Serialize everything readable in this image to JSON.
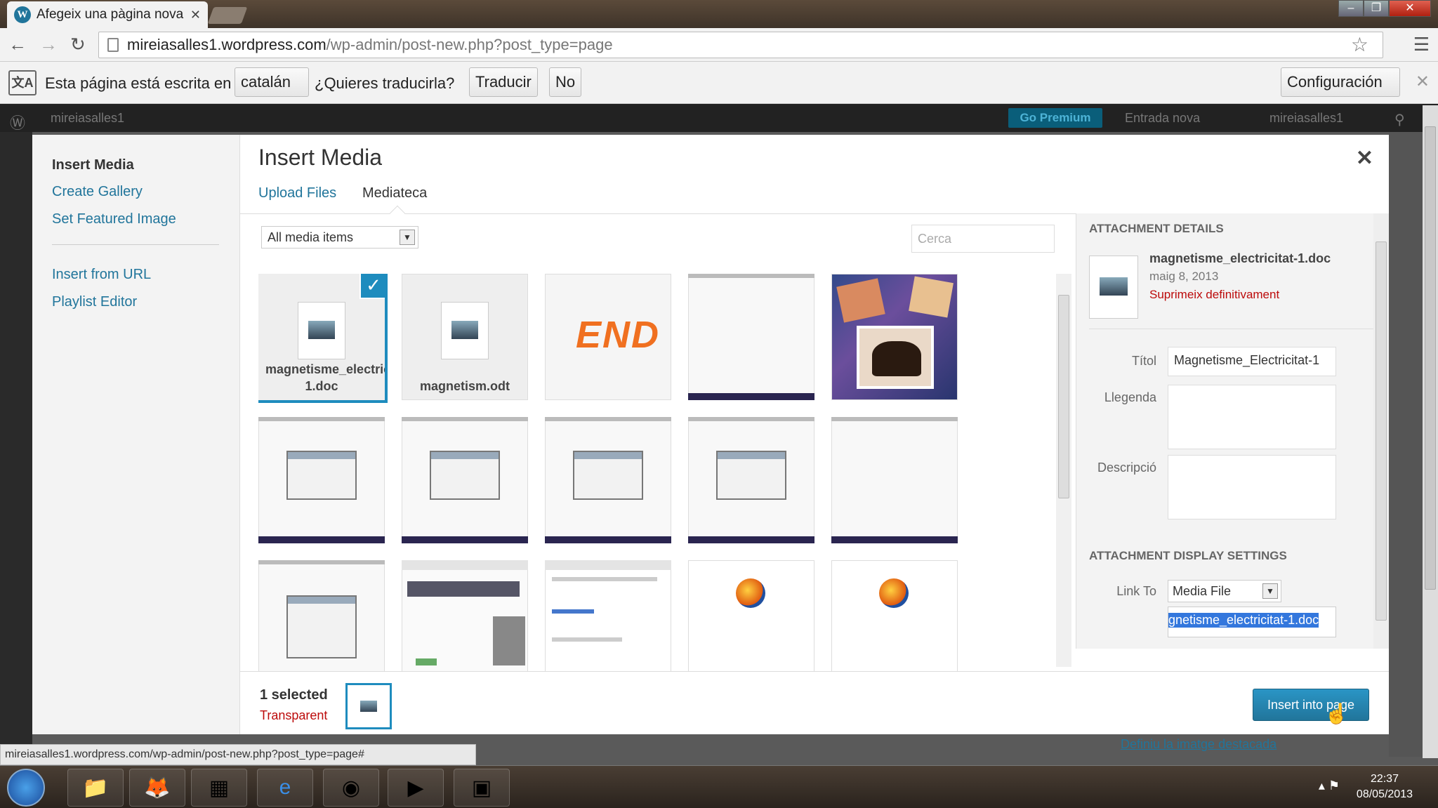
{
  "browser": {
    "tab_title": "Afegeix una pàgina nova ‹",
    "url_domain": "mireiasalles1.wordpress.com",
    "url_path": "/wp-admin/post-new.php?post_type=page"
  },
  "translate_bar": {
    "text_prefix": "Esta página está escrita en",
    "language": "catalán",
    "question": "¿Quieres traducirla?",
    "translate_button": "Traducir",
    "no_button": "No",
    "settings_button": "Configuración"
  },
  "admin_bar": {
    "site": "mireiasalles1",
    "go_premium": "Go Premium",
    "new_post": "Entrada nova",
    "user": "mireiasalles1"
  },
  "media_modal": {
    "menu": {
      "insert_media": "Insert Media",
      "create_gallery": "Create Gallery",
      "set_featured": "Set Featured Image",
      "insert_url": "Insert from URL",
      "playlist_editor": "Playlist Editor"
    },
    "title": "Insert Media",
    "router": {
      "upload": "Upload Files",
      "library": "Mediateca"
    },
    "filter": "All media items",
    "search_placeholder": "Cerca",
    "attachments": [
      {
        "name": "magnetisme_electricitat-1.doc",
        "type": "doc",
        "selected": true
      },
      {
        "name": "magnetism.odt",
        "type": "doc"
      },
      {
        "name": "END",
        "type": "image"
      },
      {
        "type": "screenshot"
      },
      {
        "type": "collage"
      }
    ],
    "details": {
      "heading": "Attachment Details",
      "filename": "magnetisme_electricitat-1.doc",
      "date": "maig 8, 2013",
      "delete_link": "Suprimeix definitivament",
      "title_label": "Títol",
      "title_value": "Magnetisme_Electricitat-1",
      "caption_label": "Llegenda",
      "description_label": "Descripció",
      "display_heading": "Attachment Display Settings",
      "link_to_label": "Link To",
      "link_to_value": "Media File",
      "link_url": "gnetisme_electricitat-1.doc"
    },
    "toolbar": {
      "selected_count": "1 selected",
      "clear": "Transparent",
      "insert_button": "Insert into page"
    }
  },
  "status_url": "mireiasalles1.wordpress.com/wp-admin/post-new.php?post_type=page#",
  "page_below_link": "Definiu la imatge destacada",
  "clock": {
    "time": "22:37",
    "date": "08/05/2013"
  }
}
